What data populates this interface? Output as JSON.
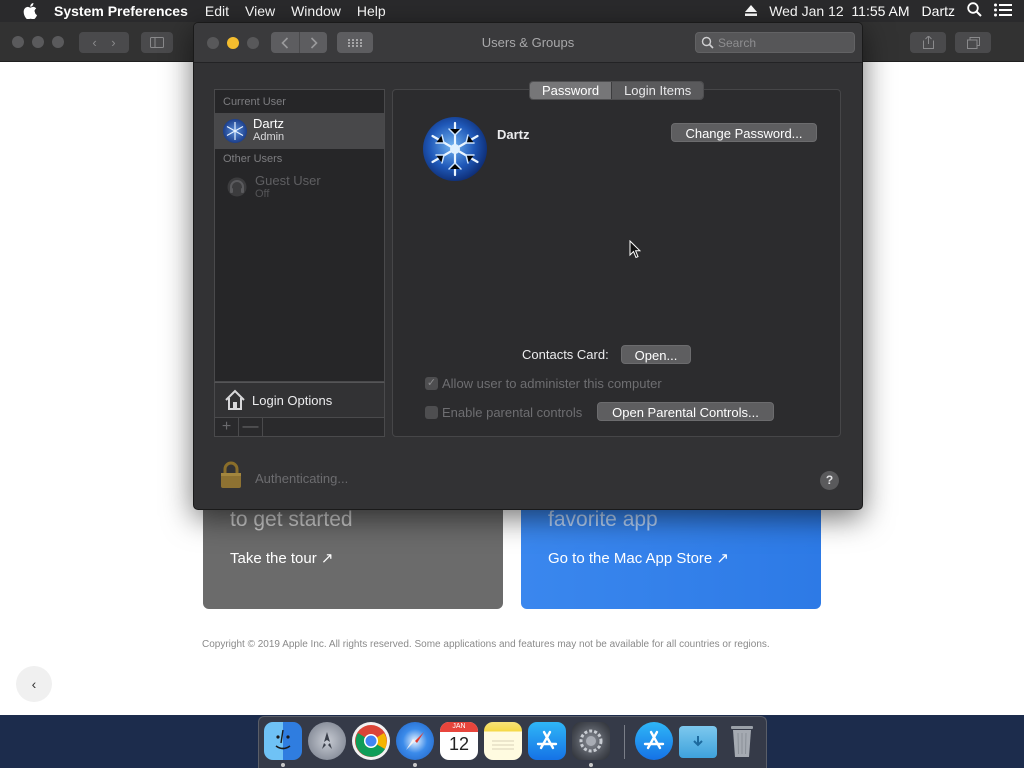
{
  "menubar": {
    "app_name": "System Preferences",
    "items": [
      "Edit",
      "View",
      "Window",
      "Help"
    ],
    "datetime": "Wed Jan 12  11:55 AM",
    "user": "Dartz"
  },
  "window": {
    "title": "Users & Groups",
    "search_placeholder": "Search"
  },
  "sidebar": {
    "current_user_header": "Current User",
    "current_user": {
      "name": "Dartz",
      "role": "Admin"
    },
    "other_users_header": "Other Users",
    "other_users": [
      {
        "name": "Guest User",
        "status": "Off"
      }
    ],
    "login_options_label": "Login Options",
    "add_label": "+",
    "remove_label": "—"
  },
  "tabs": [
    {
      "label": "Password",
      "active": true
    },
    {
      "label": "Login Items",
      "active": false
    }
  ],
  "main": {
    "user_name": "Dartz",
    "change_password_button": "Change Password...",
    "contacts_card_label": "Contacts Card:",
    "open_button": "Open...",
    "allow_admin_label": "Allow user to administer this computer",
    "allow_admin_checked": true,
    "parental_controls_label": "Enable parental controls",
    "parental_controls_checked": false,
    "open_parental_controls_button": "Open Parental Controls..."
  },
  "footer": {
    "status_text": "Authenticating...",
    "help_label": "?"
  },
  "background_page": {
    "card_left_headline": "to get started",
    "card_left_cta": "Take the tour ↗",
    "card_right_headline": "favorite app",
    "card_right_cta": "Go to the Mac App Store ↗",
    "copyright": "Copyright © 2019 Apple Inc. All rights reserved. Some applications and features may not be available for all countries or regions."
  },
  "dock": {
    "apps": [
      "finder-icon",
      "launchpad-icon",
      "chrome-icon",
      "safari-icon",
      "calendar-icon",
      "notes-icon",
      "app-store-icon",
      "system-preferences-icon",
      "app-store-downloads-icon",
      "downloads-folder-icon",
      "trash-icon"
    ],
    "calendar_month": "JAN",
    "calendar_day": "12"
  },
  "colors": {
    "window_bg": "#323234",
    "accent_blue": "#3a87ee",
    "menubar_bg": "#2a2a2c"
  }
}
